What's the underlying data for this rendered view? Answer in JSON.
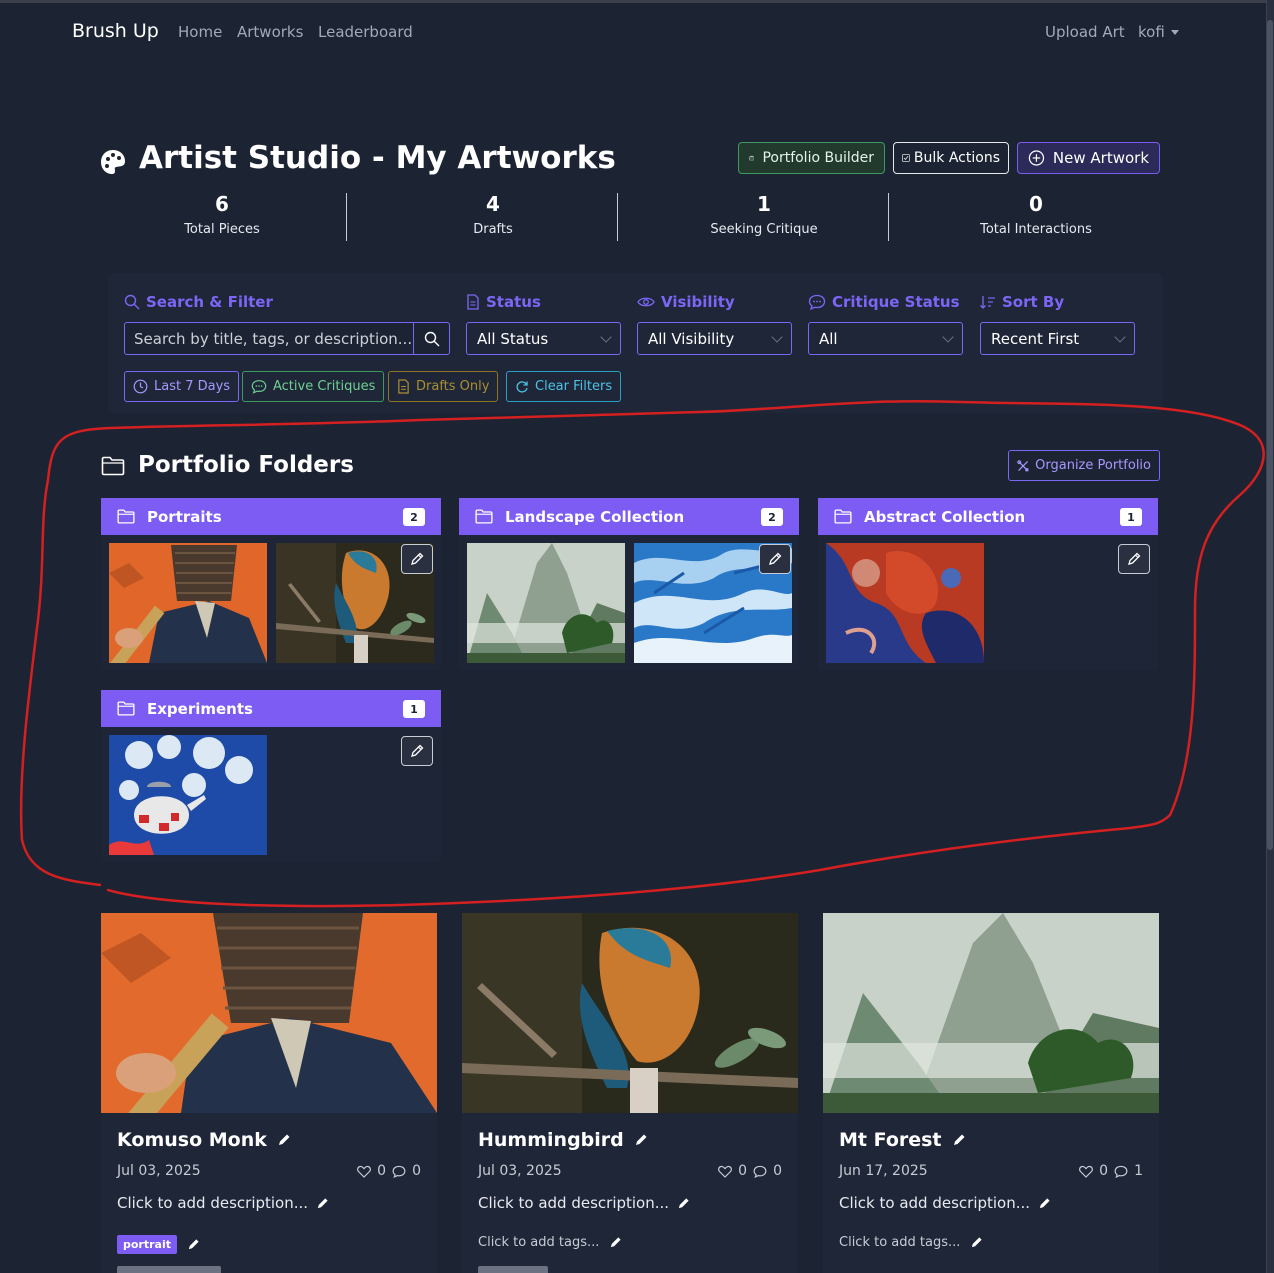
{
  "nav": {
    "brand": "Brush Up",
    "links": [
      "Home",
      "Artworks",
      "Leaderboard"
    ],
    "upload": "Upload Art",
    "user": "kofi"
  },
  "header": {
    "title": "Artist Studio - My Artworks",
    "buttons": {
      "portfolio": "Portfolio Builder",
      "bulk": "Bulk Actions",
      "new": "New Artwork"
    }
  },
  "stats": [
    {
      "value": "6",
      "label": "Total Pieces"
    },
    {
      "value": "4",
      "label": "Drafts"
    },
    {
      "value": "1",
      "label": "Seeking Critique"
    },
    {
      "value": "0",
      "label": "Total Interactions"
    }
  ],
  "filters": {
    "search_label": "Search & Filter",
    "search_placeholder": "Search by title, tags, or description...",
    "status_label": "Status",
    "status_value": "All Status",
    "visibility_label": "Visibility",
    "visibility_value": "All Visibility",
    "critique_label": "Critique Status",
    "critique_value": "All",
    "sort_label": "Sort By",
    "sort_value": "Recent First",
    "chips": {
      "last7": "Last 7 Days",
      "active": "Active Critiques",
      "drafts": "Drafts Only",
      "clear": "Clear Filters"
    }
  },
  "folders": {
    "title": "Portfolio Folders",
    "organize": "Organize Portfolio",
    "items": [
      {
        "name": "Portraits",
        "count": "2"
      },
      {
        "name": "Landscape Collection",
        "count": "2"
      },
      {
        "name": "Abstract Collection",
        "count": "1"
      },
      {
        "name": "Experiments",
        "count": "1"
      }
    ]
  },
  "artworks": [
    {
      "title": "Komuso Monk",
      "date": "Jul 03, 2025",
      "likes": "0",
      "comments": "0",
      "description": "Click to add description...",
      "tag": "portrait"
    },
    {
      "title": "Hummingbird",
      "date": "Jul 03, 2025",
      "likes": "0",
      "comments": "0",
      "description": "Click to add description...",
      "tags_placeholder": "Click to add tags..."
    },
    {
      "title": "Mt Forest",
      "date": "Jun 17, 2025",
      "likes": "0",
      "comments": "1",
      "description": "Click to add description...",
      "tags_placeholder": "Click to add tags..."
    }
  ],
  "colors": {
    "background": "#1c2333",
    "accent": "#7c5cf2",
    "annotation": "#d42020"
  }
}
